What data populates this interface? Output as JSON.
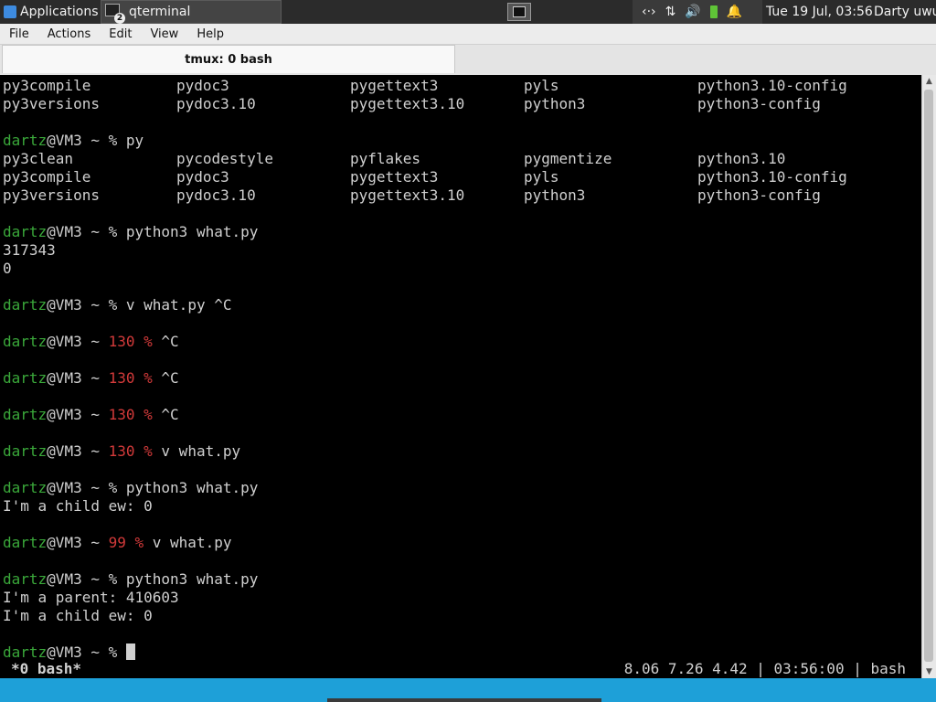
{
  "panel": {
    "applications": "Applications",
    "task_title": "qterminal",
    "task_badge": "2",
    "clock": "Tue 19 Jul, 03:56",
    "user": "Darty uwu",
    "tray": {
      "net_glyph": "‹·›",
      "transfer_glyph": "⇅",
      "volume_glyph": "🔊",
      "bell_glyph": "🔔"
    }
  },
  "menu": [
    "File",
    "Actions",
    "Edit",
    "View",
    "Help"
  ],
  "tab": {
    "label": "tmux: 0 bash"
  },
  "terminal": {
    "lines": [
      {
        "cols": [
          "py3compile",
          "pydoc3",
          "pygettext3",
          "pyls",
          "python3.10-config"
        ]
      },
      {
        "cols": [
          "py3versions",
          "pydoc3.10",
          "pygettext3.10",
          "python3",
          "python3-config"
        ]
      },
      {
        "text": ""
      },
      {
        "user": "dartz",
        "host": "@VM3 ~ ",
        "code": "",
        "sign": "%",
        "cmd": " py"
      },
      {
        "cols": [
          "py3clean",
          "pycodestyle",
          "pyflakes",
          "pygmentize",
          "python3.10"
        ]
      },
      {
        "cols": [
          "py3compile",
          "pydoc3",
          "pygettext3",
          "pyls",
          "python3.10-config"
        ]
      },
      {
        "cols": [
          "py3versions",
          "pydoc3.10",
          "pygettext3.10",
          "python3",
          "python3-config"
        ]
      },
      {
        "text": ""
      },
      {
        "user": "dartz",
        "host": "@VM3 ~ ",
        "code": "",
        "sign": "%",
        "cmd": " python3 what.py"
      },
      {
        "text": "317343"
      },
      {
        "text": "0"
      },
      {
        "text": ""
      },
      {
        "user": "dartz",
        "host": "@VM3 ~ ",
        "code": "",
        "sign": "%",
        "cmd": " v what.py ^C"
      },
      {
        "text": ""
      },
      {
        "user": "dartz",
        "host": "@VM3 ~ ",
        "code": "130 %",
        "sign": "",
        "cmd": " ^C"
      },
      {
        "text": ""
      },
      {
        "user": "dartz",
        "host": "@VM3 ~ ",
        "code": "130 %",
        "sign": "",
        "cmd": " ^C"
      },
      {
        "text": ""
      },
      {
        "user": "dartz",
        "host": "@VM3 ~ ",
        "code": "130 %",
        "sign": "",
        "cmd": " ^C"
      },
      {
        "text": ""
      },
      {
        "user": "dartz",
        "host": "@VM3 ~ ",
        "code": "130 %",
        "sign": "",
        "cmd": " v what.py"
      },
      {
        "text": ""
      },
      {
        "user": "dartz",
        "host": "@VM3 ~ ",
        "code": "",
        "sign": "%",
        "cmd": " python3 what.py"
      },
      {
        "text": "I'm a child ew: 0"
      },
      {
        "text": ""
      },
      {
        "user": "dartz",
        "host": "@VM3 ~ ",
        "code": "99 %",
        "sign": "",
        "cmd": " v what.py"
      },
      {
        "text": ""
      },
      {
        "user": "dartz",
        "host": "@VM3 ~ ",
        "code": "",
        "sign": "%",
        "cmd": " python3 what.py"
      },
      {
        "text": "I'm a parent: 410603"
      },
      {
        "text": "I'm a child ew: 0"
      },
      {
        "text": ""
      },
      {
        "user": "dartz",
        "host": "@VM3 ~ ",
        "code": "",
        "sign": "%",
        "cmd": " ",
        "cursor": true
      }
    ]
  },
  "status": {
    "left": "*0 bash*",
    "right": "8.06 7.26 4.42 | 03:56:00 | bash"
  }
}
